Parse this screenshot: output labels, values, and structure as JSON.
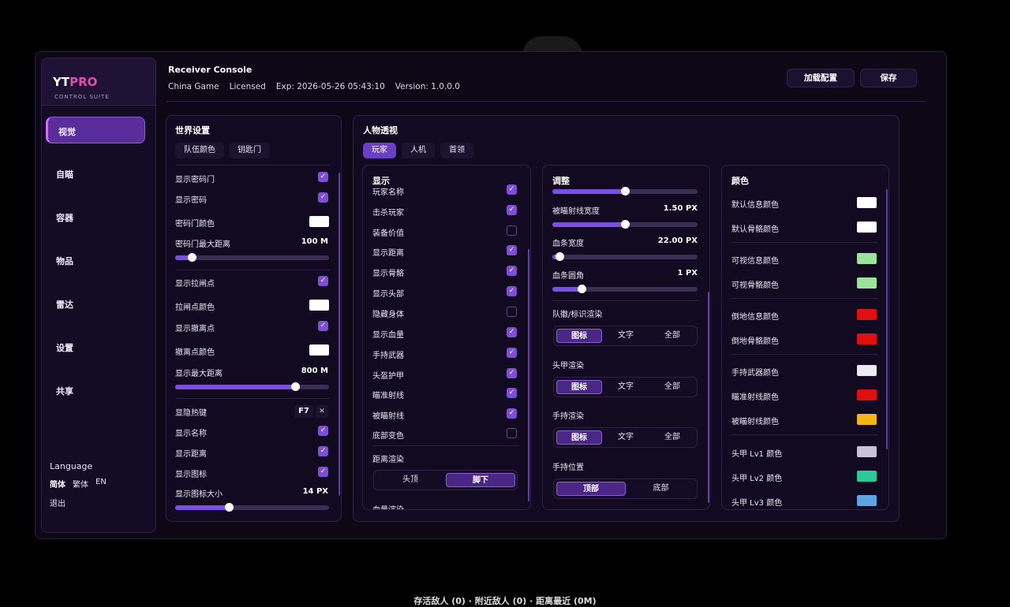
{
  "header": {
    "title": "Receiver Console",
    "game": "China Game",
    "license": "Licensed",
    "expiry": "Exp: 2026-05-26 05:43:10",
    "version": "Version: 1.0.0.0",
    "load_config": "加载配置",
    "save": "保存"
  },
  "sidebar": {
    "logo_main": "YT",
    "logo_accent": "PRO",
    "logo_sub": "CONTROL SUITE",
    "items": [
      "视觉",
      "自瞄",
      "容器",
      "物品",
      "雷达",
      "设置",
      "共享"
    ],
    "language_label": "Language",
    "languages": [
      "简体",
      "繁体",
      "EN"
    ],
    "exit": "退出"
  },
  "world": {
    "title": "世界设置",
    "tabs": [
      "队伍颜色",
      "钥匙门"
    ],
    "rows": {
      "show_key_door": "显示密码门",
      "show_code": "显示密码",
      "key_door_color": "密码门颜色",
      "key_door_max": "密码门最大距离",
      "key_door_max_val": "100 M",
      "show_switch": "显示拉闸点",
      "switch_color": "拉闸点颜色",
      "show_exit": "显示撤离点",
      "exit_color": "撤离点颜色",
      "max_dist": "显示最大距离",
      "max_dist_val": "800 M",
      "hide_hotkey": "显隐热键",
      "hotkey": "F7",
      "show_name": "显示名称",
      "show_distance": "显示距离",
      "show_icon": "显示图标",
      "icon_size": "显示图标大小",
      "icon_size_val": "14 PX"
    },
    "sliders": {
      "key_door_max": 0.11,
      "max_dist": 0.78,
      "icon_size": 0.35
    }
  },
  "esp": {
    "title": "人物透视",
    "tabs": [
      "玩家",
      "人机",
      "首领"
    ],
    "display": {
      "title": "显示",
      "items": [
        [
          "玩家名称",
          true
        ],
        [
          "击杀玩家",
          true
        ],
        [
          "装备价值",
          false
        ],
        [
          "显示距离",
          true
        ],
        [
          "显示骨骼",
          true
        ],
        [
          "显示头部",
          true
        ],
        [
          "隐藏身体",
          false
        ],
        [
          "显示血量",
          true
        ],
        [
          "手持武器",
          true
        ],
        [
          "头盔护甲",
          true
        ],
        [
          "瞄准射线",
          true
        ],
        [
          "被瞄射线",
          true
        ],
        [
          "底部变色",
          false
        ]
      ],
      "dist_render": "距离渲染",
      "dist_opts": [
        "头顶",
        "脚下"
      ],
      "hp_render": "血量渲染"
    },
    "adjust": {
      "title": "调整",
      "aim_line_width": "被瞄射线宽度",
      "aim_line_width_val": "1.50 PX",
      "hp_width": "血条宽度",
      "hp_width_val": "22.00 PX",
      "hp_round": "血条圆角",
      "hp_round_val": "1 PX",
      "sliders": [
        0.5,
        0.5,
        0.05,
        0.2
      ],
      "team_render": "队徽/标识渲染",
      "helmet_render": "头甲渲染",
      "weapon_render": "手持渲染",
      "render_opts": [
        "图标",
        "文字",
        "全部"
      ],
      "weapon_pos": "手持位置",
      "pos_opts": [
        "顶部",
        "底部"
      ]
    },
    "colors": {
      "title": "颜色",
      "items": [
        [
          "默认信息颜色",
          "#ffffff"
        ],
        [
          "默认骨骼颜色",
          "#ffffff"
        ],
        [
          "可视信息颜色",
          "#9be39b"
        ],
        [
          "可视骨骼颜色",
          "#9be39b"
        ],
        [
          "倒地信息颜色",
          "#e01010"
        ],
        [
          "倒地骨骼颜色",
          "#e01010"
        ],
        [
          "手持武器颜色",
          "#ecebf2"
        ],
        [
          "瞄准射线颜色",
          "#e01010"
        ],
        [
          "被瞄射线颜色",
          "#f5b512"
        ],
        [
          "头甲 Lv1 颜色",
          "#c9c3d6"
        ],
        [
          "头甲 Lv2 颜色",
          "#2cc99a"
        ],
        [
          "头甲 Lv3 颜色",
          "#5fa3e0"
        ]
      ]
    }
  },
  "status": "存活敌人 (0) · 附近敌人 (0) · 距离最近 (0M)"
}
